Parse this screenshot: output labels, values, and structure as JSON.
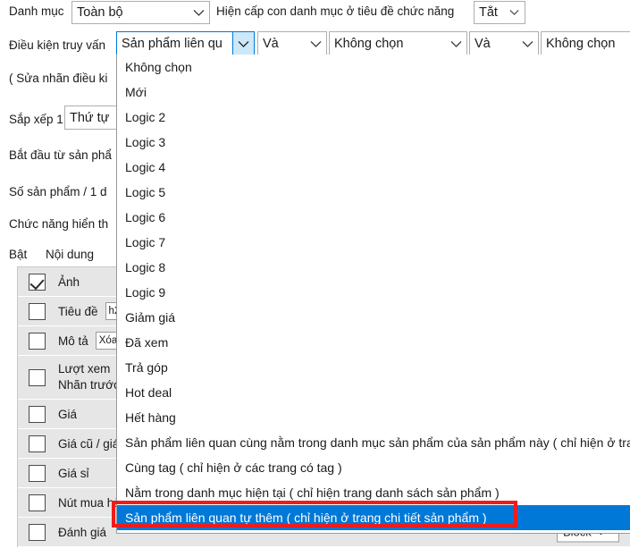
{
  "top_bar": {
    "category_label": "Danh mục",
    "category_value": "Toàn bộ",
    "subcategory_label": "Hiện cấp con danh mục ở tiêu đề chức năng",
    "subcategory_value": "Tắt"
  },
  "query_row": {
    "label": "Điều kiện truy vấn",
    "condition_value": "Sản phẩm liên qu",
    "operator_1": "Và",
    "condition_2": "Không chọn",
    "operator_2": "Và",
    "condition_3": "Không chọn"
  },
  "side_rows": {
    "edit_label_note": "( Sửa nhãn điều ki",
    "sort_label": "Sắp xếp 1",
    "sort_value": "Thứ tự",
    "start_from_label": "Bắt đầu từ sản phẩ",
    "per_page_label": "Số sản phẩm / 1 d",
    "display_function_label": "Chức năng hiển th",
    "col_enable": "Bật",
    "col_content": "Nội dung"
  },
  "content_rows": [
    {
      "name": "Ảnh",
      "checked": true,
      "mini": "",
      "right": ""
    },
    {
      "name": "Tiêu đề",
      "checked": false,
      "mini": "h2",
      "right": ""
    },
    {
      "name": "Mô tả",
      "checked": false,
      "mini": "Xóa c",
      "right": ""
    },
    {
      "name": "Lượt xem",
      "name2": "Nhãn trước",
      "checked": false,
      "mini": "",
      "right": ""
    },
    {
      "name": "Giá",
      "checked": false,
      "mini": "",
      "right": ""
    },
    {
      "name": "Giá cũ / giá",
      "checked": false,
      "mini": "",
      "right": ""
    },
    {
      "name": "Giá sỉ",
      "checked": false,
      "mini": "",
      "right": ""
    },
    {
      "name": "Nút mua hà",
      "checked": false,
      "mini": "",
      "right": ""
    },
    {
      "name": "Đánh giá",
      "checked": false,
      "mini": "",
      "right": "Block"
    }
  ],
  "dropdown": {
    "options": [
      "Không chọn",
      "Mới",
      "Logic 2",
      "Logic 3",
      "Logic 4",
      "Logic 5",
      "Logic 6",
      "Logic 7",
      "Logic 8",
      "Logic 9",
      "Giảm giá",
      "Đã xem",
      "Trả góp",
      "Hot deal",
      "Hết hàng",
      "Sản phẩm liên quan cùng nằm trong danh mục sản phẩm của sản phẩm này ( chỉ hiện ở trang chi tiết sản phẩm )",
      "Cùng tag ( chỉ hiện ở các trang có tag )",
      "Nằm trong danh mục hiện tại ( chỉ hiện trang danh sách sản phẩm )",
      "Sản phẩm liên quan tự thêm ( chỉ hiện ở trang chi tiết sản phẩm )"
    ],
    "selected_index": 18
  },
  "colors": {
    "selection_blue": "#0078d7",
    "annotation_red": "#ee1c1c",
    "row_gray": "#e6e6e6",
    "focus_arrow_blue": "#cde8f8"
  }
}
